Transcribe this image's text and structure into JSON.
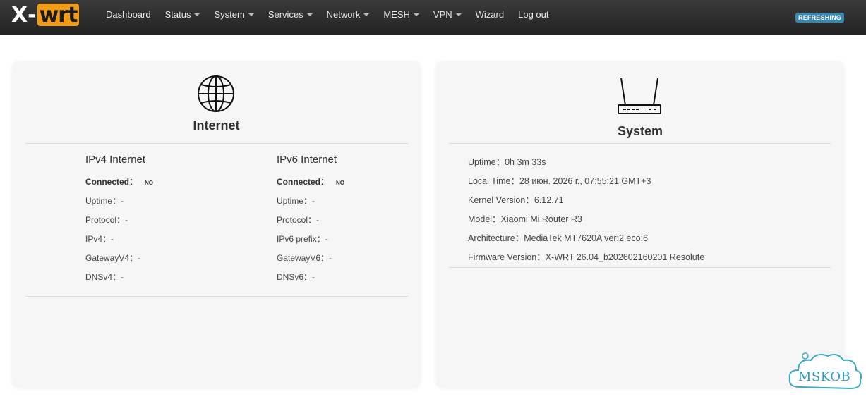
{
  "brand": {
    "x": "X",
    "dash": "-",
    "wrt": "wrt"
  },
  "nav": {
    "items": [
      {
        "label": "Dashboard",
        "dropdown": false
      },
      {
        "label": "Status",
        "dropdown": true
      },
      {
        "label": "System",
        "dropdown": true
      },
      {
        "label": "Services",
        "dropdown": true
      },
      {
        "label": "Network",
        "dropdown": true
      },
      {
        "label": "MESH",
        "dropdown": true
      },
      {
        "label": "VPN",
        "dropdown": true
      },
      {
        "label": "Wizard",
        "dropdown": false
      },
      {
        "label": "Log out",
        "dropdown": false
      }
    ],
    "status_badge": "REFRESHING"
  },
  "internet": {
    "title": "Internet",
    "icon": "globe-icon",
    "ipv4": {
      "heading": "IPv4 Internet",
      "connected_label": "Connected：",
      "connected_value": "NO",
      "rows": [
        {
          "label": "Uptime：",
          "value": "-"
        },
        {
          "label": "Protocol：",
          "value": "-"
        },
        {
          "label": "IPv4：",
          "value": "-"
        },
        {
          "label": "GatewayV4：",
          "value": "-"
        },
        {
          "label": "DNSv4：",
          "value": "-"
        }
      ]
    },
    "ipv6": {
      "heading": "IPv6 Internet",
      "connected_label": "Connected：",
      "connected_value": "NO",
      "rows": [
        {
          "label": "Uptime：",
          "value": "-"
        },
        {
          "label": "Protocol：",
          "value": "-"
        },
        {
          "label": "IPv6 prefix：",
          "value": "-"
        },
        {
          "label": "GatewayV6：",
          "value": "-"
        },
        {
          "label": "DNSv6：",
          "value": "-"
        }
      ]
    }
  },
  "system": {
    "title": "System",
    "icon": "router-icon",
    "rows": [
      {
        "label": "Uptime：",
        "value": "0h 3m 33s"
      },
      {
        "label": "Local Time：",
        "value": "28 июн. 2026 г., 07:55:21 GMT+3"
      },
      {
        "label": "Kernel Version：",
        "value": "6.12.71"
      },
      {
        "label": "Model：",
        "value": "Xiaomi Mi Router R3"
      },
      {
        "label": "Architecture：",
        "value": "MediaTek MT7620A ver:2 eco:6"
      },
      {
        "label": "Firmware Version：",
        "value": "X-WRT 26.04_b202602160201 Resolute"
      }
    ]
  },
  "watermark": {
    "text": "MSKOB"
  },
  "colors": {
    "navbar": "#222222",
    "brand_accent": "#f39c12",
    "badge": "#3a87ad",
    "card": "#f6f6f6"
  }
}
